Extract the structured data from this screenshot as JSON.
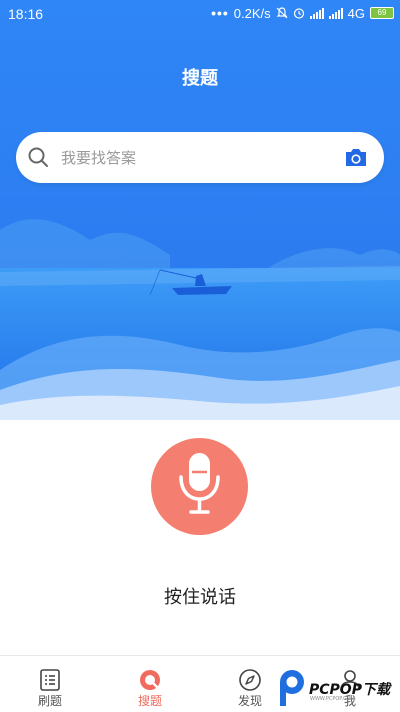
{
  "status_bar": {
    "time": "18:16",
    "dots": "•••",
    "net_speed": "0.2K/s",
    "network": "4G",
    "battery": "69"
  },
  "header": {
    "title": "搜题"
  },
  "search": {
    "placeholder": "我要找答案",
    "search_icon": "search-icon",
    "camera_icon": "camera-icon"
  },
  "voice": {
    "icon": "microphone-icon",
    "hint": "按住说话",
    "button_color": "#f47f70"
  },
  "tabbar": {
    "tabs": [
      {
        "label": "刷题",
        "icon": "list-icon",
        "active": false
      },
      {
        "label": "搜题",
        "icon": "search-circle-icon",
        "active": true
      },
      {
        "label": "发现",
        "icon": "compass-icon",
        "active": false
      },
      {
        "label": "我",
        "icon": "user-icon",
        "active": false
      }
    ],
    "active_color": "#f06b5e"
  },
  "watermark": {
    "text": "PCPOP下载",
    "sub": "WWW.PCPOP.COM"
  },
  "colors": {
    "hero_blue": "#2f86f6",
    "accent_red": "#f47f70"
  }
}
